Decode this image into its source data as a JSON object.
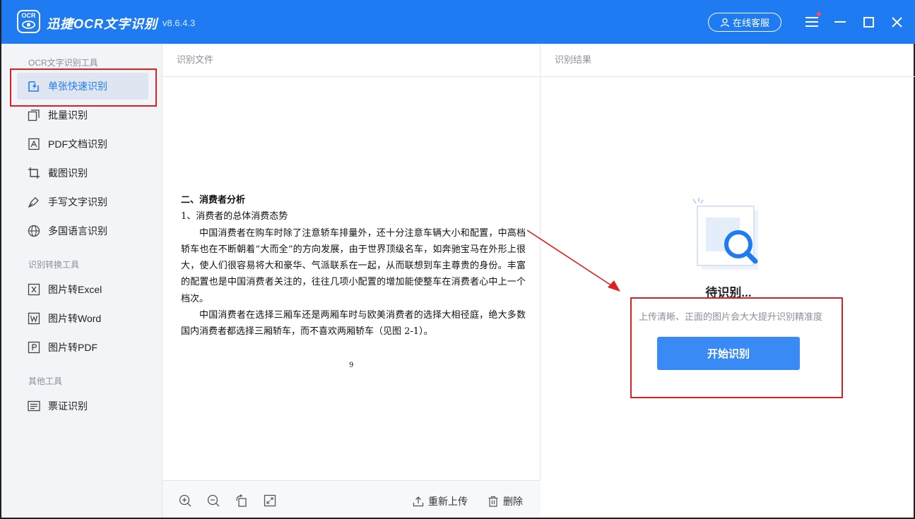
{
  "app": {
    "logo_text": "OCR",
    "title": "迅捷OCR文字识别",
    "version": "v8.6.4.3",
    "customer_service": "在线客服"
  },
  "sidebar": {
    "group1_title": "OCR文字识别工具",
    "group1_items": [
      {
        "label": "单张快速识别",
        "icon": "quick-scan-icon"
      },
      {
        "label": "批量识别",
        "icon": "batch-icon"
      },
      {
        "label": "PDF文档识别",
        "icon": "pdf-icon"
      },
      {
        "label": "截图识别",
        "icon": "crop-icon"
      },
      {
        "label": "手写文字识别",
        "icon": "pen-icon"
      },
      {
        "label": "多国语言识别",
        "icon": "globe-icon"
      }
    ],
    "group2_title": "识别转换工具",
    "group2_items": [
      {
        "label": "图片转Excel",
        "icon": "excel-icon"
      },
      {
        "label": "图片转Word",
        "icon": "word-icon"
      },
      {
        "label": "图片转PDF",
        "icon": "pdf-convert-icon"
      }
    ],
    "group3_title": "其他工具",
    "group3_items": [
      {
        "label": "票证识别",
        "icon": "ticket-icon"
      }
    ]
  },
  "file_panel": {
    "header": "识别文件",
    "document": {
      "heading": "二、消费者分析",
      "subheading": "1、消费者的总体消费态势",
      "paragraph1": "中国消费者在购车时除了注意轿车排量外，还十分注意车辆大小和配置，中高档轿车也在不断朝着“大而全”的方向发展，由于世界顶级名车，如奔驰宝马在外形上很大，使人们很容易将大和豪华、气派联系在一起，从而联想到车主尊贵的身份。丰富的配置也是中国消费者关注的，往往几项小配置的增加能使整车在消费者心中上一个档次。",
      "paragraph2": "中国消费者在选择三厢车还是两厢车时与欧美消费者的选择大相径庭，绝大多数国内消费者都选择三厢轿车，而不喜欢两厢轿车（见图 2-1）。",
      "page_number": "9"
    },
    "toolbar": {
      "reupload": "重新上传",
      "delete": "删除"
    }
  },
  "result_panel": {
    "header": "识别结果",
    "status": "待识别...",
    "hint": "上传清晰、正面的图片会大大提升识别精准度",
    "start_button": "开始识别"
  },
  "colors": {
    "brand": "#1e7bf2",
    "button": "#3a8af5",
    "highlight": "#e02020"
  }
}
